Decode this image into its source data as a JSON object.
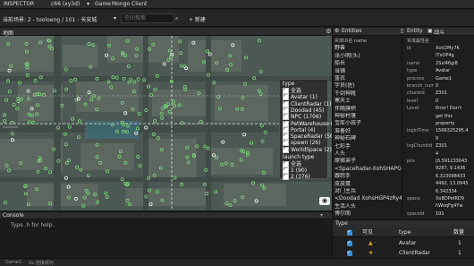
{
  "menubar": {
    "app_name": "INSPECTOR",
    "project": "c66 (xy3d)",
    "menu_game": "Game",
    "menu_client": "Mongo Client"
  },
  "toolbar": {
    "scene_label": "当前场景: 2 - tooloeng / 101 - 长安城",
    "search_placeholder": "空间搜索",
    "add_label": "+ 新建"
  },
  "map": {
    "title": "地图",
    "filter": {
      "header": "type",
      "items": [
        "全选",
        "Avatar (1)",
        "ClientRadar (1)",
        "Doodad (45)",
        "NPC (1706)",
        "PetWarehouse (1)",
        "Portal (4)",
        "SpaceRadar (50)",
        "spawn (26)",
        "WorldSpace (2)"
      ],
      "sub_header": "launch type",
      "sub_items": [
        "全选",
        "1 (90)",
        "2 (376)"
      ]
    }
  },
  "console": {
    "title": "Console",
    "prompt": "Type .h for help."
  },
  "statusbar": {
    "left": "Game1",
    "right": "0x:连接成功"
  },
  "entities": {
    "title": "Entities",
    "tab2": "Entity",
    "tab3": "战斗",
    "list_header": "实体ID名 name",
    "detail_header": "实体属性名",
    "list": [
      "实体ID名 name",
      "野兽",
      "张小明(头)",
      "船长",
      "当铺",
      "蓝衣",
      "学员(佐)",
      "千剑神靴",
      "寒天士",
      "伴随旗帜",
      "神秘村落",
      "宝库小孩子",
      "准备好",
      "神秘石碑",
      "七彩手",
      "人头",
      "原宿弟子",
      "<SpaceRadar-XohSHAPG4...",
      "跟踪手",
      "皮皮蛋",
      "对门主兵",
      "<Doodad XohsHGP4zRy4...",
      "生活人头",
      "博尔阁"
    ],
    "detail": [
      {
        "k": "id",
        "v": "XoV2My7K"
      },
      {
        "k": "",
        "v": "iTxOP4g"
      },
      {
        "k": "name",
        "v": "2Sxl46gi8"
      },
      {
        "k": "type",
        "v": "Avatar"
      },
      {
        "k": "process",
        "v": "Game1"
      },
      {
        "k": "branch_num",
        "v": "0"
      },
      {
        "k": "chunkid",
        "v": "Z301"
      },
      {
        "k": "level",
        "v": "0"
      },
      {
        "k": "Level",
        "v": "Error! Don't"
      },
      {
        "k": "",
        "v": "get this"
      },
      {
        "k": "",
        "v": "property"
      },
      {
        "k": "loginTime",
        "v": "1566325295.4"
      },
      {
        "k": "",
        "v": "9"
      },
      {
        "k": "lvgChunkId",
        "v": "Z301"
      },
      {
        "k": "",
        "v": "4"
      },
      {
        "k": "pos",
        "v": "[6.591233043"
      },
      {
        "k": "",
        "v": "9287, 9.1436"
      },
      {
        "k": "",
        "v": "6.323098433"
      },
      {
        "k": "",
        "v": "4492, 13.0945"
      },
      {
        "k": "",
        "v": "6.342334"
      },
      {
        "k": "space",
        "v": "XoBDPefRD9"
      },
      {
        "k": "",
        "v": "hWoqFg4Yw"
      },
      {
        "k": "spaceId",
        "v": "101"
      }
    ]
  },
  "type_table": {
    "title": "Type",
    "col_visible": "可见",
    "col_type": "type",
    "col_count": "数量",
    "rows": [
      {
        "icon": "▲ ·",
        "type": "Avatar",
        "count": "1"
      },
      {
        "icon": "★ ·",
        "type": "ClientRadar",
        "count": "1"
      }
    ]
  },
  "colors": {
    "accent": "#3a8fd6",
    "map_bg": "#4d5a55",
    "npc_marker": "#7bd37b",
    "dashed_line": "#e0e0e0"
  }
}
